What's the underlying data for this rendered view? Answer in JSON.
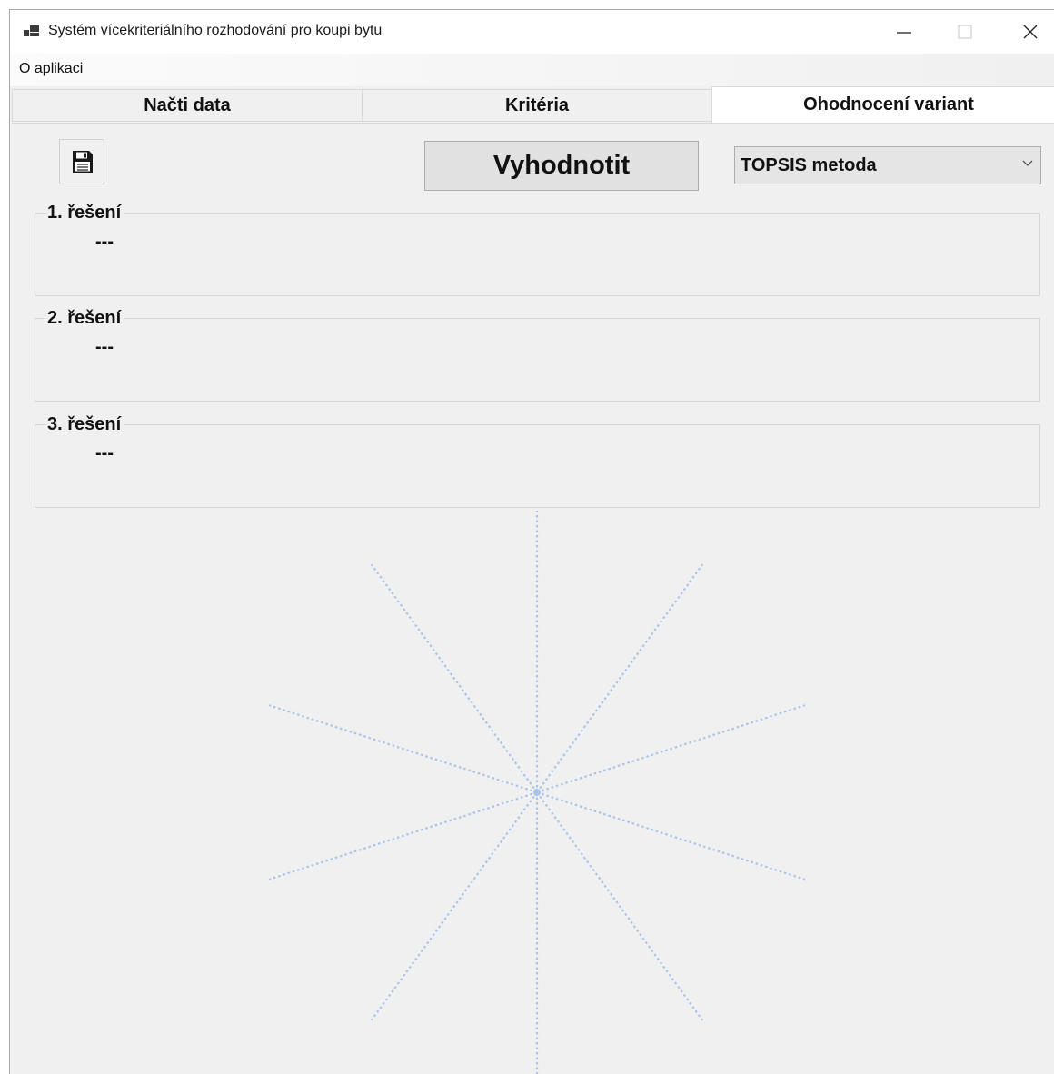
{
  "window": {
    "title": "Systém vícekriteriálního rozhodování pro koupi bytu"
  },
  "menu": {
    "items": [
      {
        "label": "O aplikaci"
      }
    ]
  },
  "tabs": [
    {
      "label": "Načti data",
      "selected": false
    },
    {
      "label": "Kritéria",
      "selected": false
    },
    {
      "label": "Ohodnocení variant",
      "selected": true
    }
  ],
  "toolbar": {
    "save_icon": "floppy-disk-icon",
    "evaluate_label": "Vyhodnotit",
    "method_selected": "TOPSIS metoda"
  },
  "results": [
    {
      "title": "1. řešení",
      "value": "---"
    },
    {
      "title": "2. řešení",
      "value": "---"
    },
    {
      "title": "3. řešení",
      "value": "---"
    }
  ],
  "colors": {
    "spinner": "#a9c4e8",
    "window_bg": "#f0f0f0"
  }
}
